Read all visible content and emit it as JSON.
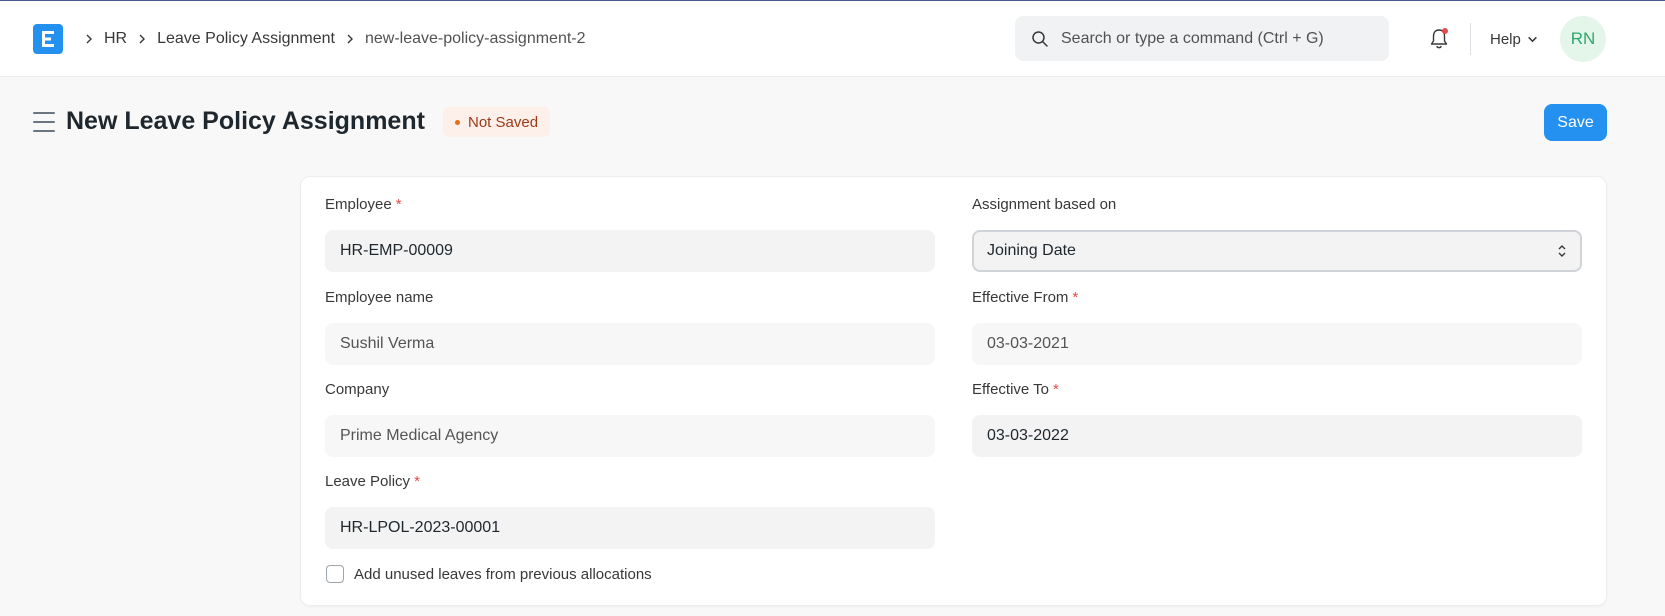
{
  "navbar": {
    "breadcrumbs": [
      "HR",
      "Leave Policy Assignment",
      "new-leave-policy-assignment-2"
    ],
    "search_placeholder": "Search or type a command (Ctrl + G)",
    "help_label": "Help",
    "avatar_initials": "RN"
  },
  "page": {
    "title": "New Leave Policy Assignment",
    "status": "Not Saved",
    "save_label": "Save"
  },
  "form": {
    "employee": {
      "label": "Employee",
      "value": "HR-EMP-00009",
      "required": true
    },
    "employee_name": {
      "label": "Employee name",
      "value": "Sushil Verma"
    },
    "company": {
      "label": "Company",
      "value": "Prime Medical Agency"
    },
    "leave_policy": {
      "label": "Leave Policy",
      "value": "HR-LPOL-2023-00001",
      "required": true
    },
    "assignment_based_on": {
      "label": "Assignment based on",
      "value": "Joining Date"
    },
    "effective_from": {
      "label": "Effective From",
      "value": "03-03-2021",
      "required": true
    },
    "effective_to": {
      "label": "Effective To",
      "value": "03-03-2022",
      "required": true
    },
    "carry_forward": {
      "label": "Add unused leaves from previous allocations",
      "checked": false
    }
  },
  "colors": {
    "primary": "#2490ef",
    "required": "#e24c4c",
    "status_bg": "#fdf0ea",
    "status_text": "#9b3a17",
    "avatar_bg": "#e4f5e9",
    "avatar_text": "#30a66d"
  },
  "icons": {
    "logo": "erpnext-logo-icon",
    "breadcrumb_separator": "chevron-right-icon",
    "search": "search-icon",
    "notifications": "bell-icon",
    "help_dropdown": "chevron-down-icon",
    "menu": "hamburger-icon",
    "select": "select-arrows-icon"
  }
}
